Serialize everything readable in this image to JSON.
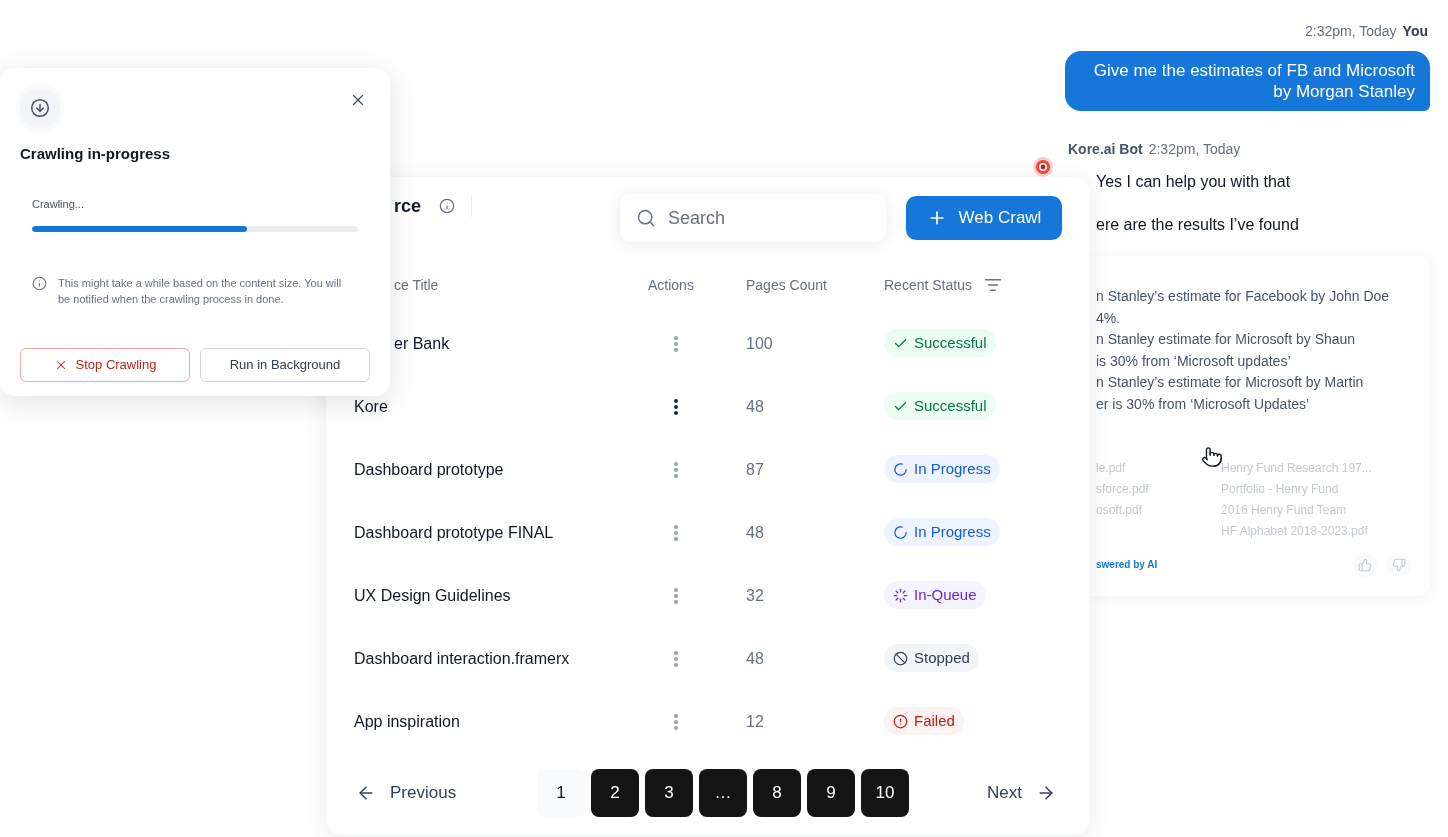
{
  "crawl_dialog": {
    "title": "Crawling in-progress",
    "progress": {
      "label": "Crawling...",
      "level": 0.66
    },
    "note": "This might take a while based on the content size. You will be notified when the crawling process in done.",
    "buttons": [
      {
        "label": "Stop Crawling",
        "kind": "danger"
      },
      {
        "label": "Run in Background",
        "kind": "secondary"
      }
    ]
  },
  "sources_table": {
    "title": "rce",
    "search": {
      "placeholder": "Search"
    },
    "add_button": "Web Crawl",
    "columns": [
      "ce Title",
      "Actions",
      "Pages Count",
      "Recent Status"
    ],
    "rows": [
      {
        "title": "er Bank",
        "actions_highlighted": false,
        "pages_count": "100",
        "status": {
          "label": "Successful",
          "kind": "successful"
        }
      },
      {
        "title": "Kore",
        "actions_highlighted": true,
        "pages_count": "48",
        "status": {
          "label": "Successful",
          "kind": "successful"
        }
      },
      {
        "title": "Dashboard prototype",
        "actions_highlighted": false,
        "pages_count": "87",
        "status": {
          "label": "In Progress",
          "kind": "in_progress"
        }
      },
      {
        "title": "Dashboard prototype FINAL",
        "actions_highlighted": false,
        "pages_count": "48",
        "status": {
          "label": "In Progress",
          "kind": "in_progress"
        }
      },
      {
        "title": "UX Design Guidelines",
        "actions_highlighted": false,
        "pages_count": "32",
        "status": {
          "label": "In-Queue",
          "kind": "in_queue"
        }
      },
      {
        "title": "Dashboard interaction.framerx",
        "actions_highlighted": false,
        "pages_count": "48",
        "status": {
          "label": "Stopped",
          "kind": "stopped"
        }
      },
      {
        "title": "App inspiration",
        "actions_highlighted": false,
        "pages_count": "12",
        "status": {
          "label": "Failed",
          "kind": "failed"
        }
      }
    ],
    "pagination": {
      "previous": "Previous",
      "pages": [
        {
          "label": "1",
          "selected": true
        },
        {
          "label": "2",
          "selected": false
        },
        {
          "label": "3",
          "selected": false
        },
        {
          "label": "…",
          "selected": false
        },
        {
          "label": "8",
          "selected": false
        },
        {
          "label": "9",
          "selected": false
        },
        {
          "label": "10",
          "selected": false
        }
      ],
      "next": "Next"
    }
  },
  "chat": {
    "user_message": {
      "time": "2:32pm, Today",
      "sender": "You",
      "text": "Give me the estimates of FB and Microsoft by Morgan Stanley"
    },
    "bot_message": {
      "sender": "Kore.ai Bot",
      "time": "2:32pm, Today",
      "lines": [
        "Yes I can help you with that",
        "ere are the results I’ve found"
      ],
      "answer": {
        "lines": [
          "n Stanley’s estimate for Facebook by John Doe",
          "4%.",
          "n Stanley estimate for Microsoft by Shaun",
          "is 30% from ‘Microsoft updates’",
          "n Stanley’s estimate for Microsoft by Martin",
          "er is 30% from ‘Microsoft Updates’"
        ],
        "sources": {
          "column_1": [
            "le.pdf",
            "sforce.pdf",
            "osoft.pdf"
          ],
          "column_2": [
            "Henry Fund Research 197...",
            "Portfolio - Henry Fund",
            "2016 Henry Fund Team",
            "HF Alphabet 2018-2023.pdf"
          ]
        },
        "ai_note": "swered by AI"
      }
    }
  }
}
